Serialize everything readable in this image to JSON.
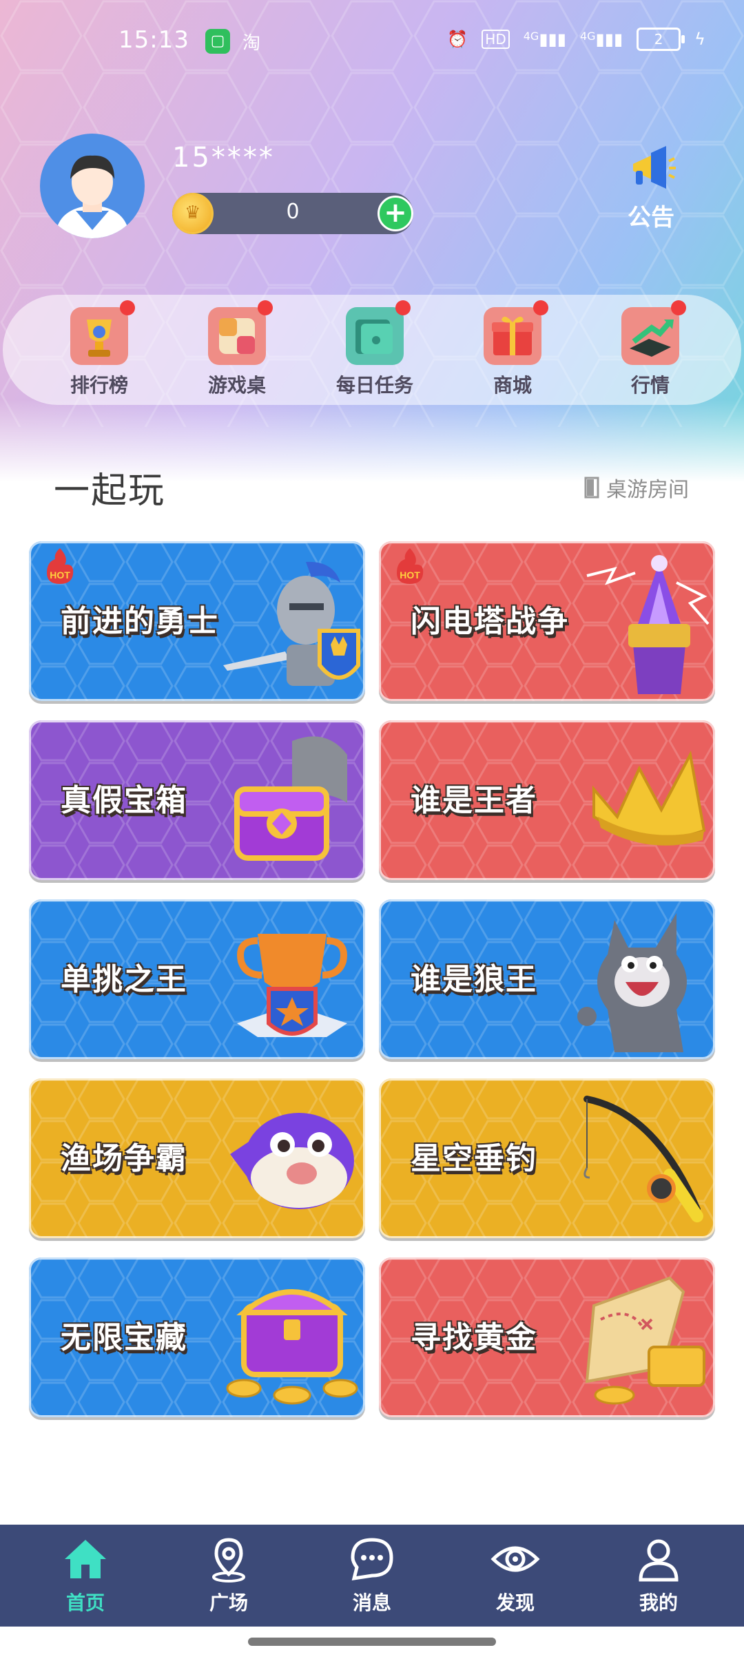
{
  "status_bar": {
    "time": "15:13",
    "app_icon_1": "淘",
    "app_icon_2": "淘",
    "hd": "HD",
    "net1": "4G",
    "net2": "4G",
    "battery": "2"
  },
  "profile": {
    "username": "15****",
    "coins": "0",
    "notice_label": "公告"
  },
  "menu": [
    {
      "label": "排行榜",
      "icon": "trophy-icon"
    },
    {
      "label": "游戏桌",
      "icon": "cube-icon"
    },
    {
      "label": "每日任务",
      "icon": "wallet-icon"
    },
    {
      "label": "商城",
      "icon": "gift-icon"
    },
    {
      "label": "行情",
      "icon": "chart-icon"
    }
  ],
  "section": {
    "title": "一起玩",
    "room_link": "桌游房间"
  },
  "games": [
    {
      "title": "前进的勇士",
      "color": "#2b8ae6",
      "hot": true,
      "art": "knight-icon"
    },
    {
      "title": "闪电塔战争",
      "color": "#e9605e",
      "hot": true,
      "art": "tower-icon"
    },
    {
      "title": "真假宝箱",
      "color": "#8d56cf",
      "hot": false,
      "art": "chest-icon"
    },
    {
      "title": "谁是王者",
      "color": "#e9605e",
      "hot": false,
      "art": "crown-icon"
    },
    {
      "title": "单挑之王",
      "color": "#2b8ae6",
      "hot": false,
      "art": "cup-icon"
    },
    {
      "title": "谁是狼王",
      "color": "#2b8ae6",
      "hot": false,
      "art": "wolf-icon"
    },
    {
      "title": "渔场争霸",
      "color": "#ebb024",
      "hot": false,
      "art": "pufferfish-icon"
    },
    {
      "title": "星空垂钓",
      "color": "#ebb024",
      "hot": false,
      "art": "fishing-rod-icon"
    },
    {
      "title": "无限宝藏",
      "color": "#2b8ae6",
      "hot": false,
      "art": "treasure-icon"
    },
    {
      "title": "寻找黄金",
      "color": "#e9605e",
      "hot": false,
      "art": "map-icon"
    }
  ],
  "hot_label": "HOT",
  "nav": [
    {
      "label": "首页",
      "icon": "home-icon",
      "active": true
    },
    {
      "label": "广场",
      "icon": "location-icon",
      "active": false
    },
    {
      "label": "消息",
      "icon": "chat-icon",
      "active": false
    },
    {
      "label": "发现",
      "icon": "eye-icon",
      "active": false
    },
    {
      "label": "我的",
      "icon": "user-icon",
      "active": false
    }
  ]
}
